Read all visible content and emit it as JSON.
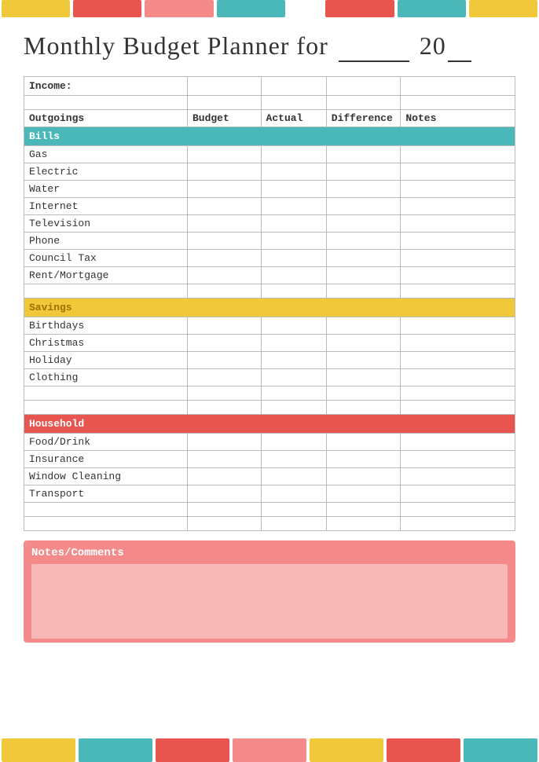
{
  "title": "Monthly Budget Planner for",
  "year_prefix": "20",
  "top_bar": [
    {
      "color": "yellow",
      "class": "seg-yellow"
    },
    {
      "color": "red",
      "class": "seg-red"
    },
    {
      "color": "pink",
      "class": "seg-pink"
    },
    {
      "color": "teal",
      "class": "seg-teal"
    },
    {
      "color": "white",
      "class": "seg-white"
    },
    {
      "color": "peach",
      "class": "seg-peach"
    },
    {
      "color": "red",
      "class": "seg-red"
    },
    {
      "color": "teal",
      "class": "seg-teal"
    }
  ],
  "bottom_bar": [
    {
      "class": "seg-yellow"
    },
    {
      "class": "seg-teal"
    },
    {
      "class": "seg-red"
    },
    {
      "class": "seg-pink"
    },
    {
      "class": "seg-yellow"
    },
    {
      "class": "seg-red"
    },
    {
      "class": "seg-teal"
    }
  ],
  "table": {
    "income_label": "Income:",
    "headers": {
      "outgoings": "Outgoings",
      "budget": "Budget",
      "actual": "Actual",
      "difference": "Difference",
      "notes": "Notes"
    },
    "sections": {
      "bills": {
        "label": "Bills",
        "items": [
          "Gas",
          "Electric",
          "Water",
          "Internet",
          "Television",
          "Phone",
          "Council Tax",
          "Rent/Mortgage"
        ]
      },
      "savings": {
        "label": "Savings",
        "items": [
          "Birthdays",
          "Christmas",
          "Holiday",
          "Clothing",
          "",
          ""
        ]
      },
      "household": {
        "label": "Household",
        "items": [
          "Food/Drink",
          "Insurance",
          "Window Cleaning",
          "Transport",
          "",
          ""
        ]
      }
    }
  },
  "notes_section": {
    "label": "Notes/Comments"
  }
}
